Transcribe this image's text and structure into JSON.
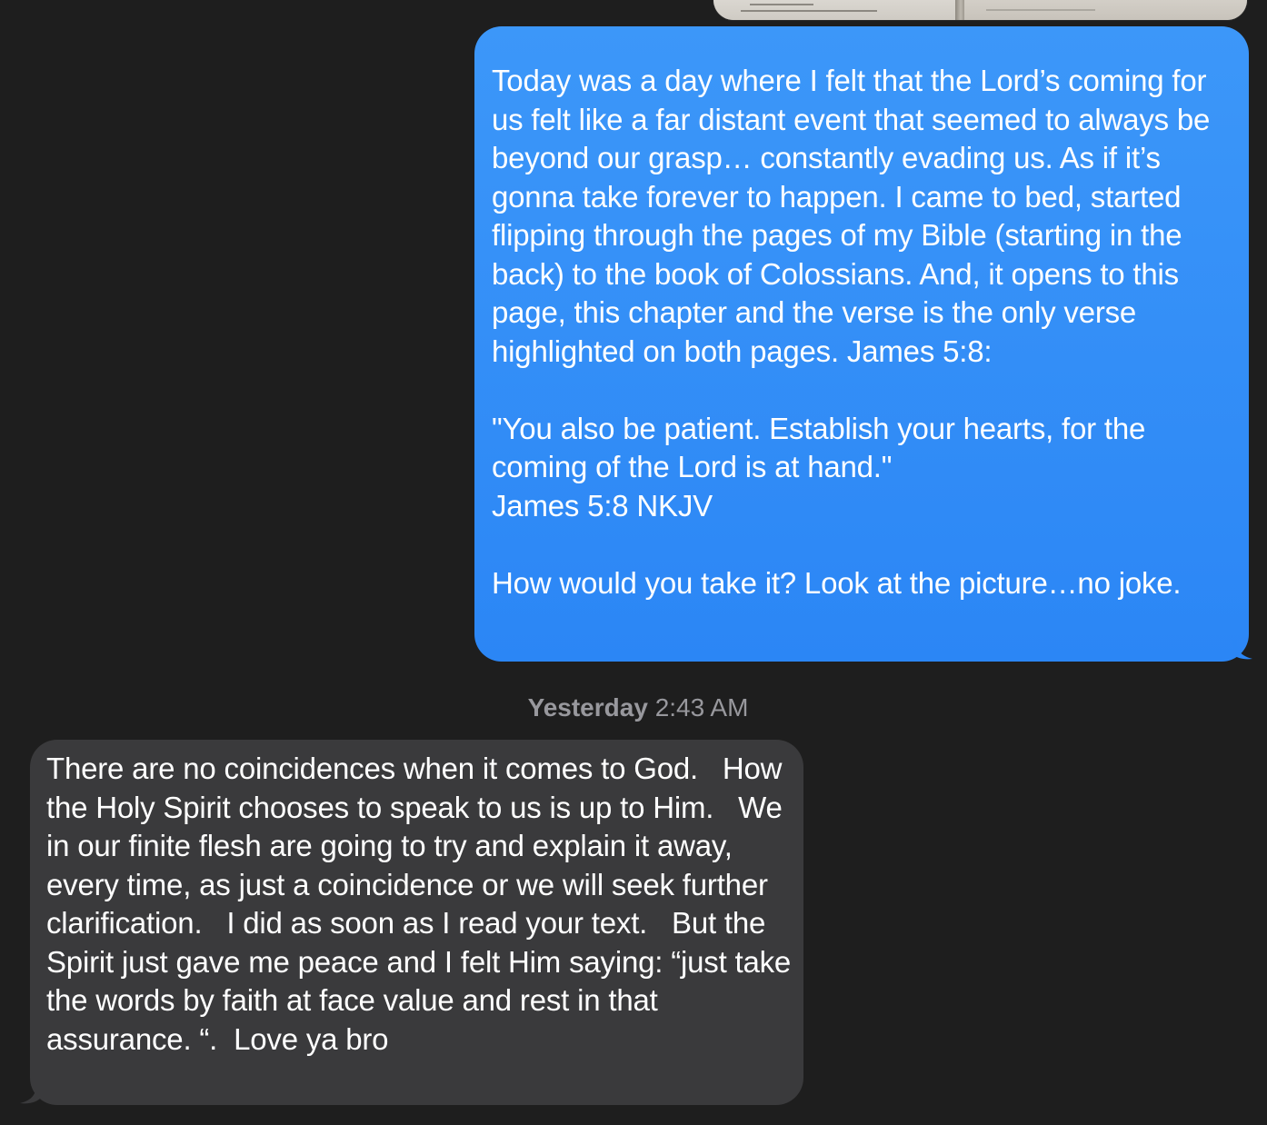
{
  "conversation": {
    "attachment_icon": "image-thumbnail",
    "sent_message": {
      "text": "Today was a day where I felt that the Lord’s coming for us felt like a far distant event that seemed to always be beyond our grasp… constantly evading us. As if it’s gonna take forever to happen. I came to bed, started flipping through the pages of my Bible (starting in the back) to the book of Colossians. And, it opens to this page, this chapter and the verse is the only verse highlighted on both pages. James 5:8:\n\n\"You also be patient. Establish your hearts, for the coming of the Lord is at hand.\"\nJames 5:8 NKJV\n\nHow would you take it? Look at the picture…no joke.",
      "bubble_color": "#2b86f5"
    },
    "timestamp": {
      "day": "Yesterday",
      "time": "2:43 AM"
    },
    "received_message": {
      "text": "There are no coincidences when it comes to God.   How the Holy Spirit chooses to speak to us is up to Him.   We in our finite flesh are going to try and explain it away, every time, as just a coincidence or we will seek further clarification.   I did as soon as I read your text.   But the Spirit just gave me peace and I felt Him saying: “just take the words by faith at face value and rest in that assurance. “.  Love ya bro",
      "bubble_color": "#3a3a3c"
    }
  }
}
